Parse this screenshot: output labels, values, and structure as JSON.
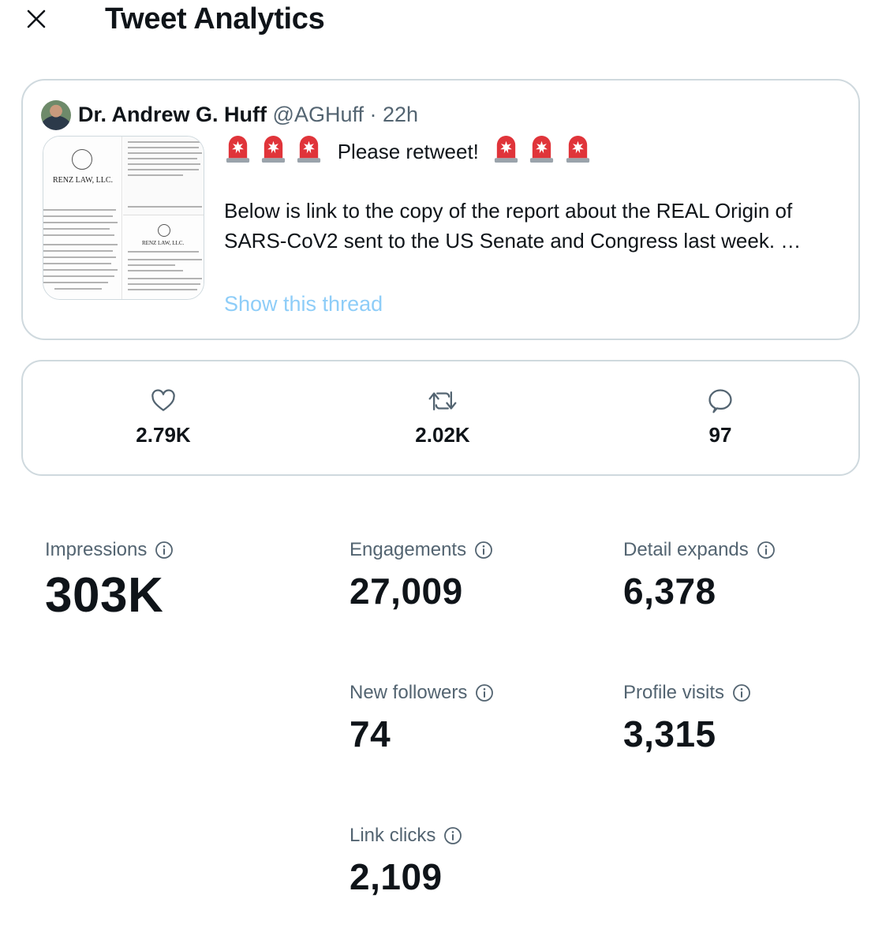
{
  "header": {
    "title": "Tweet Analytics",
    "close_icon": "close-icon"
  },
  "tweet": {
    "author_name": "Dr. Andrew G. Huff",
    "handle": "@AGHuff",
    "separator": "·",
    "time": "22h",
    "headline": "Please retweet!",
    "siren_icon": "police-car-light-emoji",
    "body": "Below is link to the copy of the report about the REAL Origin of SARS-CoV2 sent to the US Senate and Congress last week. …",
    "show_thread": "Show this thread",
    "media": {
      "firm_name_1": "RENZ LAW, LLC.",
      "firm_name_2": "RENZ LAW, LLC."
    }
  },
  "counts": [
    {
      "icon": "heart-icon",
      "value": "2.79K"
    },
    {
      "icon": "retweet-icon",
      "value": "2.02K"
    },
    {
      "icon": "reply-icon",
      "value": "97"
    }
  ],
  "metrics": {
    "impressions": {
      "label": "Impressions",
      "value": "303K"
    },
    "engagements": {
      "label": "Engagements",
      "value": "27,009"
    },
    "detail_expands": {
      "label": "Detail expands",
      "value": "6,378"
    },
    "new_followers": {
      "label": "New followers",
      "value": "74"
    },
    "profile_visits": {
      "label": "Profile visits",
      "value": "3,315"
    },
    "link_clicks": {
      "label": "Link clicks",
      "value": "2,109"
    }
  },
  "colors": {
    "text": "#0f1419",
    "secondary": "#536471",
    "link": "#8ecdf8",
    "border": "#cfd9de",
    "siren_red": "#e0343a"
  }
}
